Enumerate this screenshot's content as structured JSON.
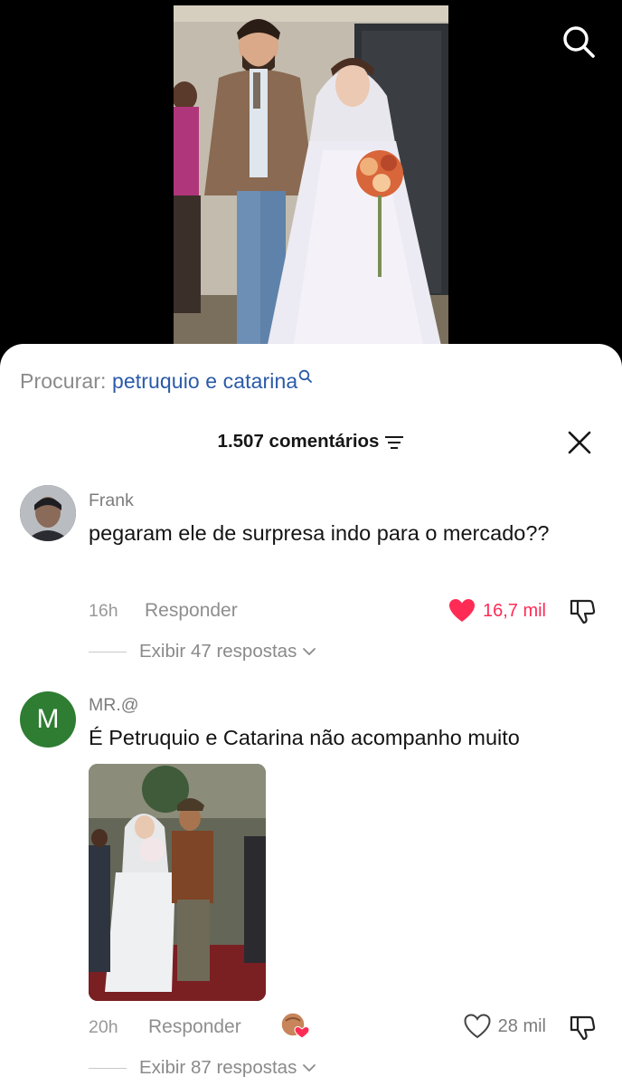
{
  "search_suggestion": {
    "prefix": "Procurar:",
    "query": "petruquio e catarina"
  },
  "comments_header": {
    "count_label": "1.507 comentários"
  },
  "comments": [
    {
      "username": "Frank",
      "text": "pegaram ele de surpresa indo para o mercado??",
      "time": "16h",
      "reply_label": "Responder",
      "likes": "16,7 mil",
      "liked": true,
      "view_replies": "Exibir 47 respostas"
    },
    {
      "username": "MR.@",
      "avatar_letter": "M",
      "text": "É Petruquio e Catarina não acompanho muito",
      "time": "20h",
      "reply_label": "Responder",
      "likes": "28 mil",
      "liked": false,
      "view_replies": "Exibir 87 respostas"
    }
  ],
  "colors": {
    "like_red": "#fe2c55",
    "link_blue": "#2b5aa8",
    "avatar_green": "#2e7d32"
  },
  "icons": [
    "search-icon",
    "sort-icon",
    "close-icon",
    "heart-filled-icon",
    "heart-outline-icon",
    "dislike-icon",
    "chevron-down-icon",
    "creator-liked-badge"
  ]
}
